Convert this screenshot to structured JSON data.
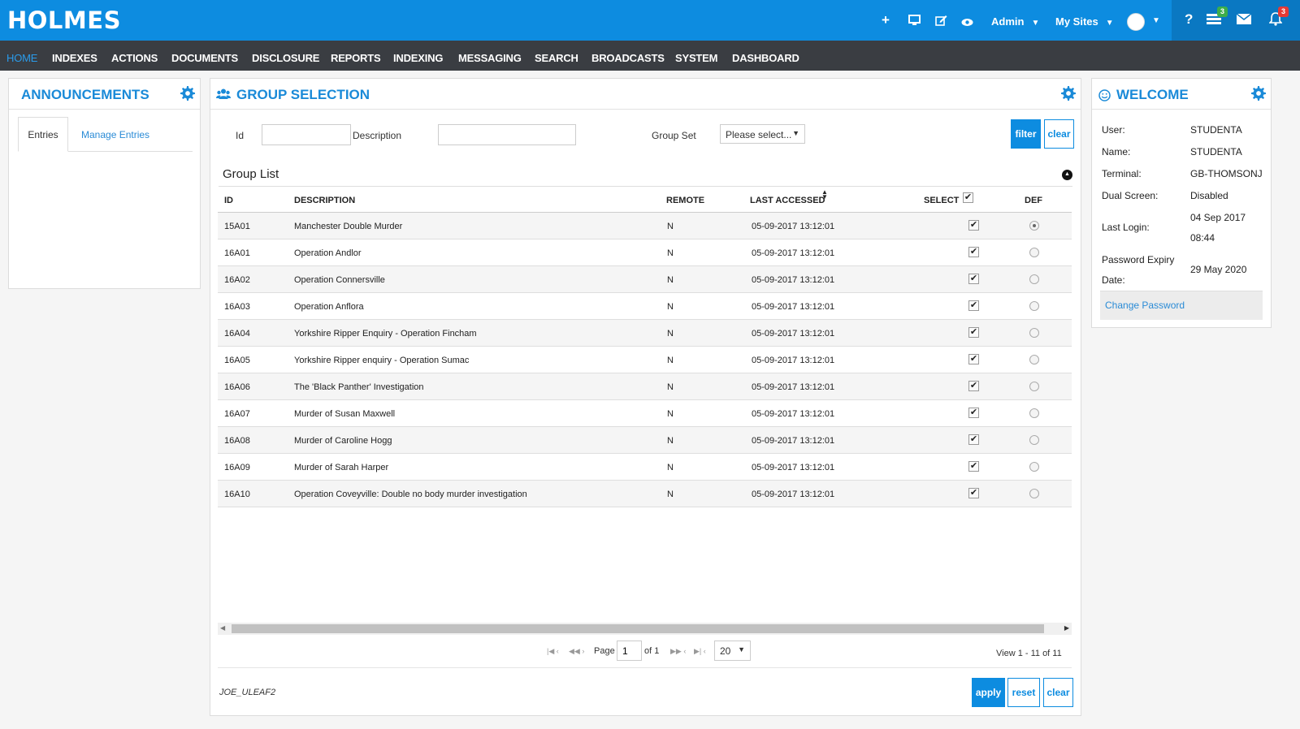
{
  "app": {
    "logo": "HOLMES"
  },
  "topbar": {
    "admin_label": "Admin",
    "mysites_label": "My Sites",
    "tasks_badge": "3",
    "alerts_badge": "3"
  },
  "menu": [
    "HOME",
    "INDEXES",
    "ACTIONS",
    "DOCUMENTS",
    "DISCLOSURE",
    "REPORTS",
    "INDEXING",
    "MESSAGING",
    "SEARCH",
    "BROADCASTS",
    "SYSTEM",
    "DASHBOARD"
  ],
  "announcements": {
    "title": "ANNOUNCEMENTS",
    "tabs": [
      "Entries",
      "Manage Entries"
    ]
  },
  "group_selection": {
    "title": "GROUP SELECTION",
    "filter": {
      "id_label": "Id",
      "id_value": "",
      "description_label": "Description",
      "description_value": "",
      "groupset_label": "Group Set",
      "groupset_value": "Please select...",
      "filter_btn": "filter",
      "clear_btn": "clear"
    },
    "list_title": "Group List",
    "columns": [
      "ID",
      "DESCRIPTION",
      "REMOTE",
      "LAST ACCESSED",
      "SELECT",
      "DEF"
    ],
    "rows": [
      {
        "id": "15A01",
        "description": "Manchester Double Murder",
        "remote": "N",
        "last_accessed": "05-09-2017 13:12:01",
        "selected": true,
        "default": true
      },
      {
        "id": "16A01",
        "description": "Operation Andlor",
        "remote": "N",
        "last_accessed": "05-09-2017 13:12:01",
        "selected": true,
        "default": false
      },
      {
        "id": "16A02",
        "description": "Operation Connersville",
        "remote": "N",
        "last_accessed": "05-09-2017 13:12:01",
        "selected": true,
        "default": false
      },
      {
        "id": "16A03",
        "description": "Operation Anflora",
        "remote": "N",
        "last_accessed": "05-09-2017 13:12:01",
        "selected": true,
        "default": false
      },
      {
        "id": "16A04",
        "description": "Yorkshire Ripper Enquiry - Operation Fincham",
        "remote": "N",
        "last_accessed": "05-09-2017 13:12:01",
        "selected": true,
        "default": false
      },
      {
        "id": "16A05",
        "description": "Yorkshire Ripper enquiry - Operation Sumac",
        "remote": "N",
        "last_accessed": "05-09-2017 13:12:01",
        "selected": true,
        "default": false
      },
      {
        "id": "16A06",
        "description": "The 'Black Panther' Investigation",
        "remote": "N",
        "last_accessed": "05-09-2017 13:12:01",
        "selected": true,
        "default": false
      },
      {
        "id": "16A07",
        "description": "Murder of Susan Maxwell",
        "remote": "N",
        "last_accessed": "05-09-2017 13:12:01",
        "selected": true,
        "default": false
      },
      {
        "id": "16A08",
        "description": "Murder of Caroline Hogg",
        "remote": "N",
        "last_accessed": "05-09-2017 13:12:01",
        "selected": true,
        "default": false
      },
      {
        "id": "16A09",
        "description": "Murder of Sarah Harper",
        "remote": "N",
        "last_accessed": "05-09-2017 13:12:01",
        "selected": true,
        "default": false
      },
      {
        "id": "16A10",
        "description": "Operation Coveyville: Double no body murder investigation",
        "remote": "N",
        "last_accessed": "05-09-2017 13:12:01",
        "selected": true,
        "default": false
      }
    ],
    "pager": {
      "page_label": "Page",
      "page_value": "1",
      "of_label": "of 1",
      "page_size": "20",
      "view_text": "View 1 - 11 of 11"
    },
    "footer_user": "JOE_ULEAF2",
    "apply_btn": "apply",
    "reset_btn": "reset",
    "clear_btn": "clear"
  },
  "welcome": {
    "title": "WELCOME",
    "user_label": "User:",
    "user_value": "STUDENTA",
    "name_label": "Name:",
    "name_value": "STUDENTA",
    "terminal_label": "Terminal:",
    "terminal_value": "GB-THOMSONJ",
    "dual_label": "Dual Screen:",
    "dual_value": "Disabled",
    "login_label": "Last Login:",
    "login_date": "04 Sep 2017",
    "login_time": "08:44",
    "expiry_label_1": "Password Expiry",
    "expiry_label_2": "Date:",
    "expiry_value": "29 May 2020",
    "change_password": "Change Password"
  },
  "colors": {
    "brand": "#0d8ce0",
    "menubar": "#3a3d42",
    "accent_text": "#1a8ad8",
    "badge_green": "#3cae4a",
    "badge_red": "#e53935"
  }
}
